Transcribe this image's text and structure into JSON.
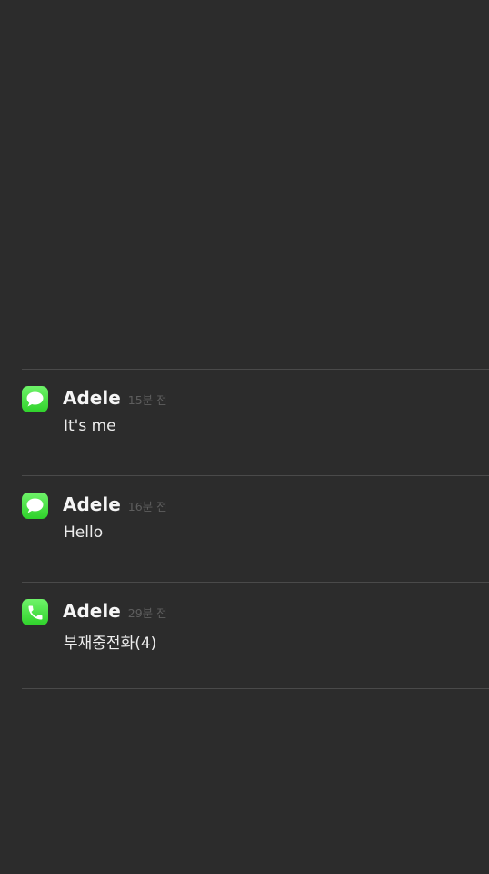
{
  "notifications": [
    {
      "app_icon": "messages-icon",
      "sender": "Adele",
      "time": "15분 전",
      "message": "It's me"
    },
    {
      "app_icon": "messages-icon",
      "sender": "Adele",
      "time": "16분 전",
      "message": "Hello"
    },
    {
      "app_icon": "phone-icon",
      "sender": "Adele",
      "time": "29분 전",
      "message": "부재중전화(4)"
    }
  ],
  "colors": {
    "background": "#2c2c2c",
    "icon_green": "#3bd835",
    "divider": "#4a4a4a"
  }
}
